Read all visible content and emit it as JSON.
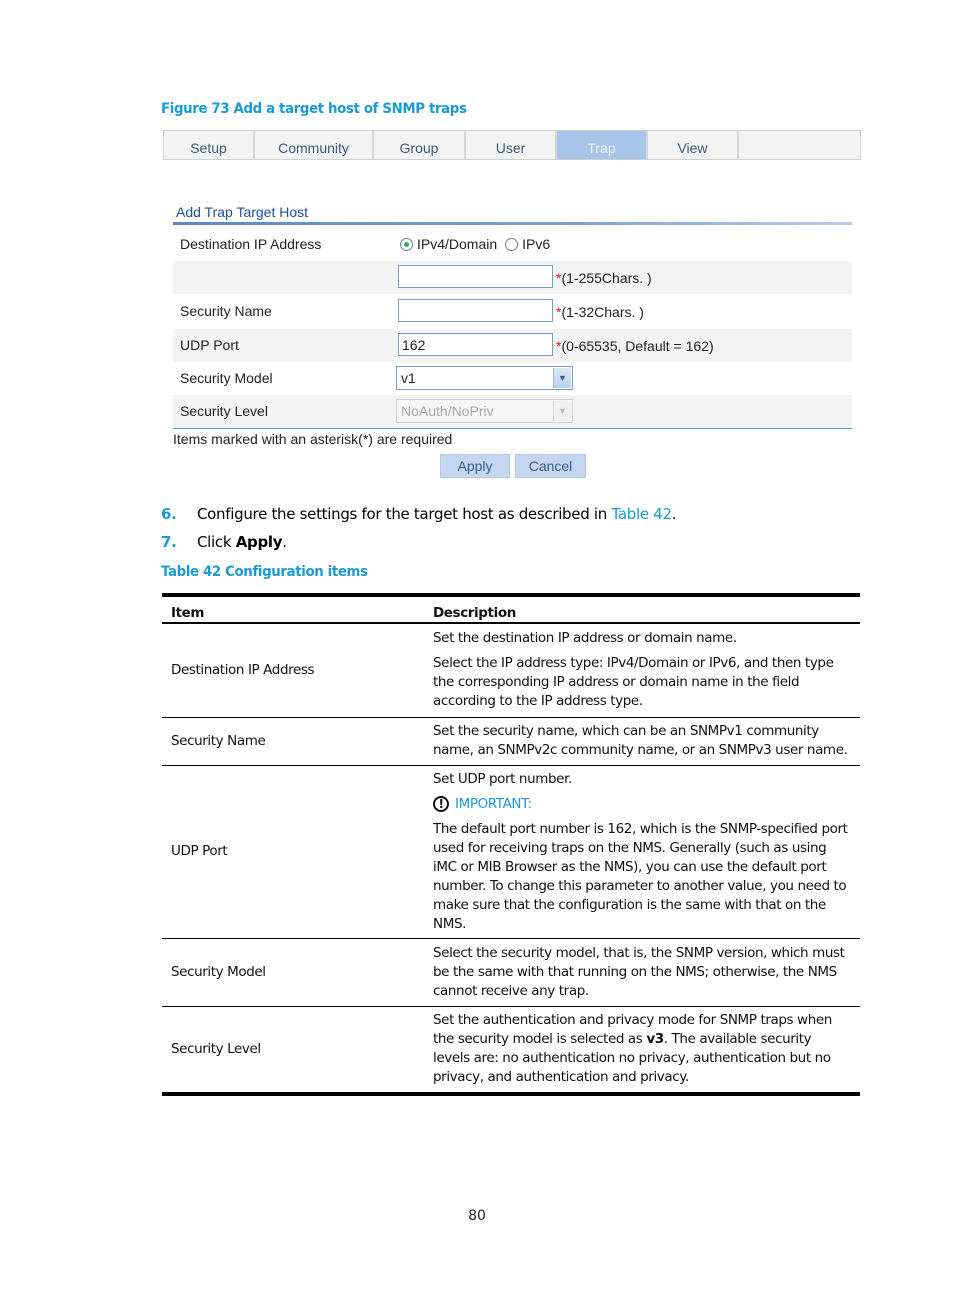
{
  "figure_caption": "Figure 73 Add a target host of SNMP traps",
  "tabs": [
    {
      "label": "Setup",
      "active": false
    },
    {
      "label": "Community",
      "active": false
    },
    {
      "label": "Group",
      "active": false
    },
    {
      "label": "User",
      "active": false
    },
    {
      "label": "Trap",
      "active": true
    },
    {
      "label": "View",
      "active": false
    }
  ],
  "form": {
    "title": "Add Trap Target Host",
    "destination": {
      "label": "Destination IP Address",
      "options": [
        {
          "label": "IPv4/Domain",
          "selected": true
        },
        {
          "label": "IPv6",
          "selected": false
        }
      ],
      "value": "",
      "hint_star": "*",
      "hint": "(1-255Chars. )"
    },
    "security_name": {
      "label": "Security Name",
      "value": "",
      "hint_star": "*",
      "hint": "(1-32Chars. )"
    },
    "udp_port": {
      "label": "UDP Port",
      "value": "162",
      "hint_star": "*",
      "hint": "(0-65535, Default = 162)"
    },
    "security_model": {
      "label": "Security Model",
      "selected": "v1"
    },
    "security_level": {
      "label": "Security Level",
      "selected": "NoAuth/NoPriv",
      "disabled": true
    },
    "required_note": "Items marked with an asterisk(*) are required",
    "apply_label": "Apply",
    "cancel_label": "Cancel"
  },
  "steps": [
    {
      "num": "6.",
      "text_before": "Configure the settings for the target host as described in ",
      "link": "Table 42",
      "text_after": "."
    },
    {
      "num": "7.",
      "text_before": "Click ",
      "bold": "Apply",
      "text_after": "."
    }
  ],
  "table_caption": "Table 42 Configuration items",
  "table": {
    "headers": [
      "Item",
      "Description"
    ],
    "rows": [
      {
        "item": "Destination IP Address",
        "desc": [
          "Set the destination IP address or domain name.",
          "Select the IP address type: IPv4/Domain or IPv6, and then type the corresponding IP address or domain name in the field according to the IP address type."
        ]
      },
      {
        "item": "Security Name",
        "desc": [
          "Set the security name, which can be an SNMPv1 community name, an SNMPv2c community name, or an SNMPv3 user name."
        ]
      },
      {
        "item": "UDP Port",
        "desc": [
          "Set UDP port number."
        ],
        "important_label": "IMPORTANT:",
        "important_text": "The default port number is 162, which is the SNMP-specified port used for receiving traps on the NMS. Generally (such as using iMC or MIB Browser as the NMS), you can use the default port number. To change this parameter to another value, you need to make sure that the configuration is the same with that on the NMS."
      },
      {
        "item": "Security Model",
        "desc": [
          "Select the security model, that is, the SNMP version, which must be the same with that running on the NMS; otherwise, the NMS cannot receive any trap."
        ]
      },
      {
        "item": "Security Level",
        "desc_before": "Set the authentication and privacy mode for SNMP traps when the security model is selected as ",
        "desc_bold": "v3",
        "desc_after": ". The available security levels are: no authentication no privacy, authentication but no privacy, and authentication and privacy."
      }
    ]
  },
  "page_number": "80"
}
